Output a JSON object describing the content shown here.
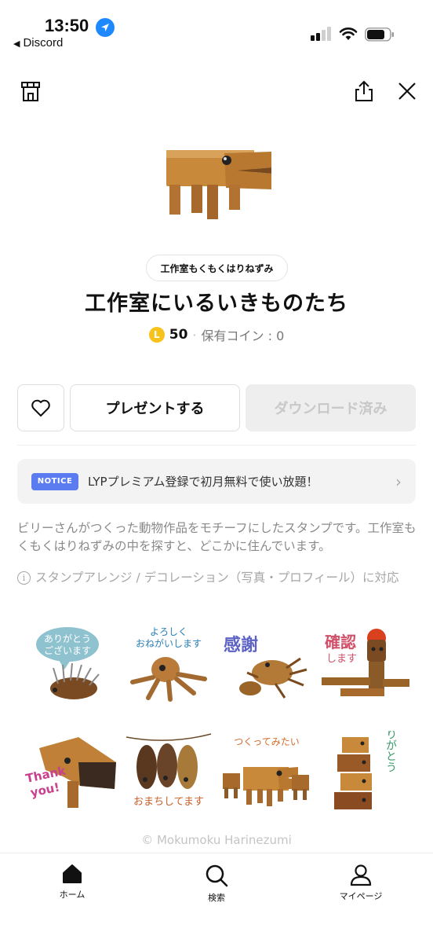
{
  "status_bar": {
    "time": "13:50",
    "back_app": "Discord"
  },
  "header": {
    "shop_icon": "shop-icon",
    "share_icon": "share-icon",
    "close_icon": "close-icon"
  },
  "product": {
    "author": "工作室もくもくはりねずみ",
    "title": "工作室にいるいきものたち",
    "coin_symbol": "L",
    "price": "50",
    "separator": "·",
    "owned_coins": "保有コイン : 0"
  },
  "actions": {
    "favorite_icon": "heart-icon",
    "gift_label": "プレゼントする",
    "download_label": "ダウンロード済み"
  },
  "notice": {
    "badge": "NOTICE",
    "text": "LYPプレミアム登録で初月無料で使い放題！",
    "chevron": "›"
  },
  "description": "ビリーさんがつくった動物作品をモチーフにしたスタンプです。工作室もくもくはりねずみの中を探すと、どこかに住んでいます。",
  "arrange_note": {
    "icon": "i",
    "text": "スタンプアレンジ / デコレーション（写真・プロフィール）に対応"
  },
  "stickers": [
    {
      "text_line1": "ありがとう",
      "text_line2": "ございます"
    },
    {
      "text_line1": "よろしく",
      "text_line2": "おねがいします"
    },
    {
      "text": "感謝"
    },
    {
      "text_line1": "確認",
      "text_line2": "します"
    },
    {
      "text_line1": "Thank",
      "text_line2": "you!"
    },
    {
      "text": "おまちしてます"
    },
    {
      "text": "つくってみたい"
    },
    {
      "text": "ありがとう"
    }
  ],
  "copyright": "© Mokumoku Harinezumi",
  "tabbar": {
    "home": "ホーム",
    "search": "検索",
    "mypage": "マイページ"
  },
  "colors": {
    "accent_blue": "#5b7cf0",
    "coin_yellow": "#f7c21b",
    "wood": "#c88a3a",
    "wood_dark": "#8a5a28",
    "disabled_bg": "#eeeeee",
    "disabled_text": "#c8c8c8"
  }
}
